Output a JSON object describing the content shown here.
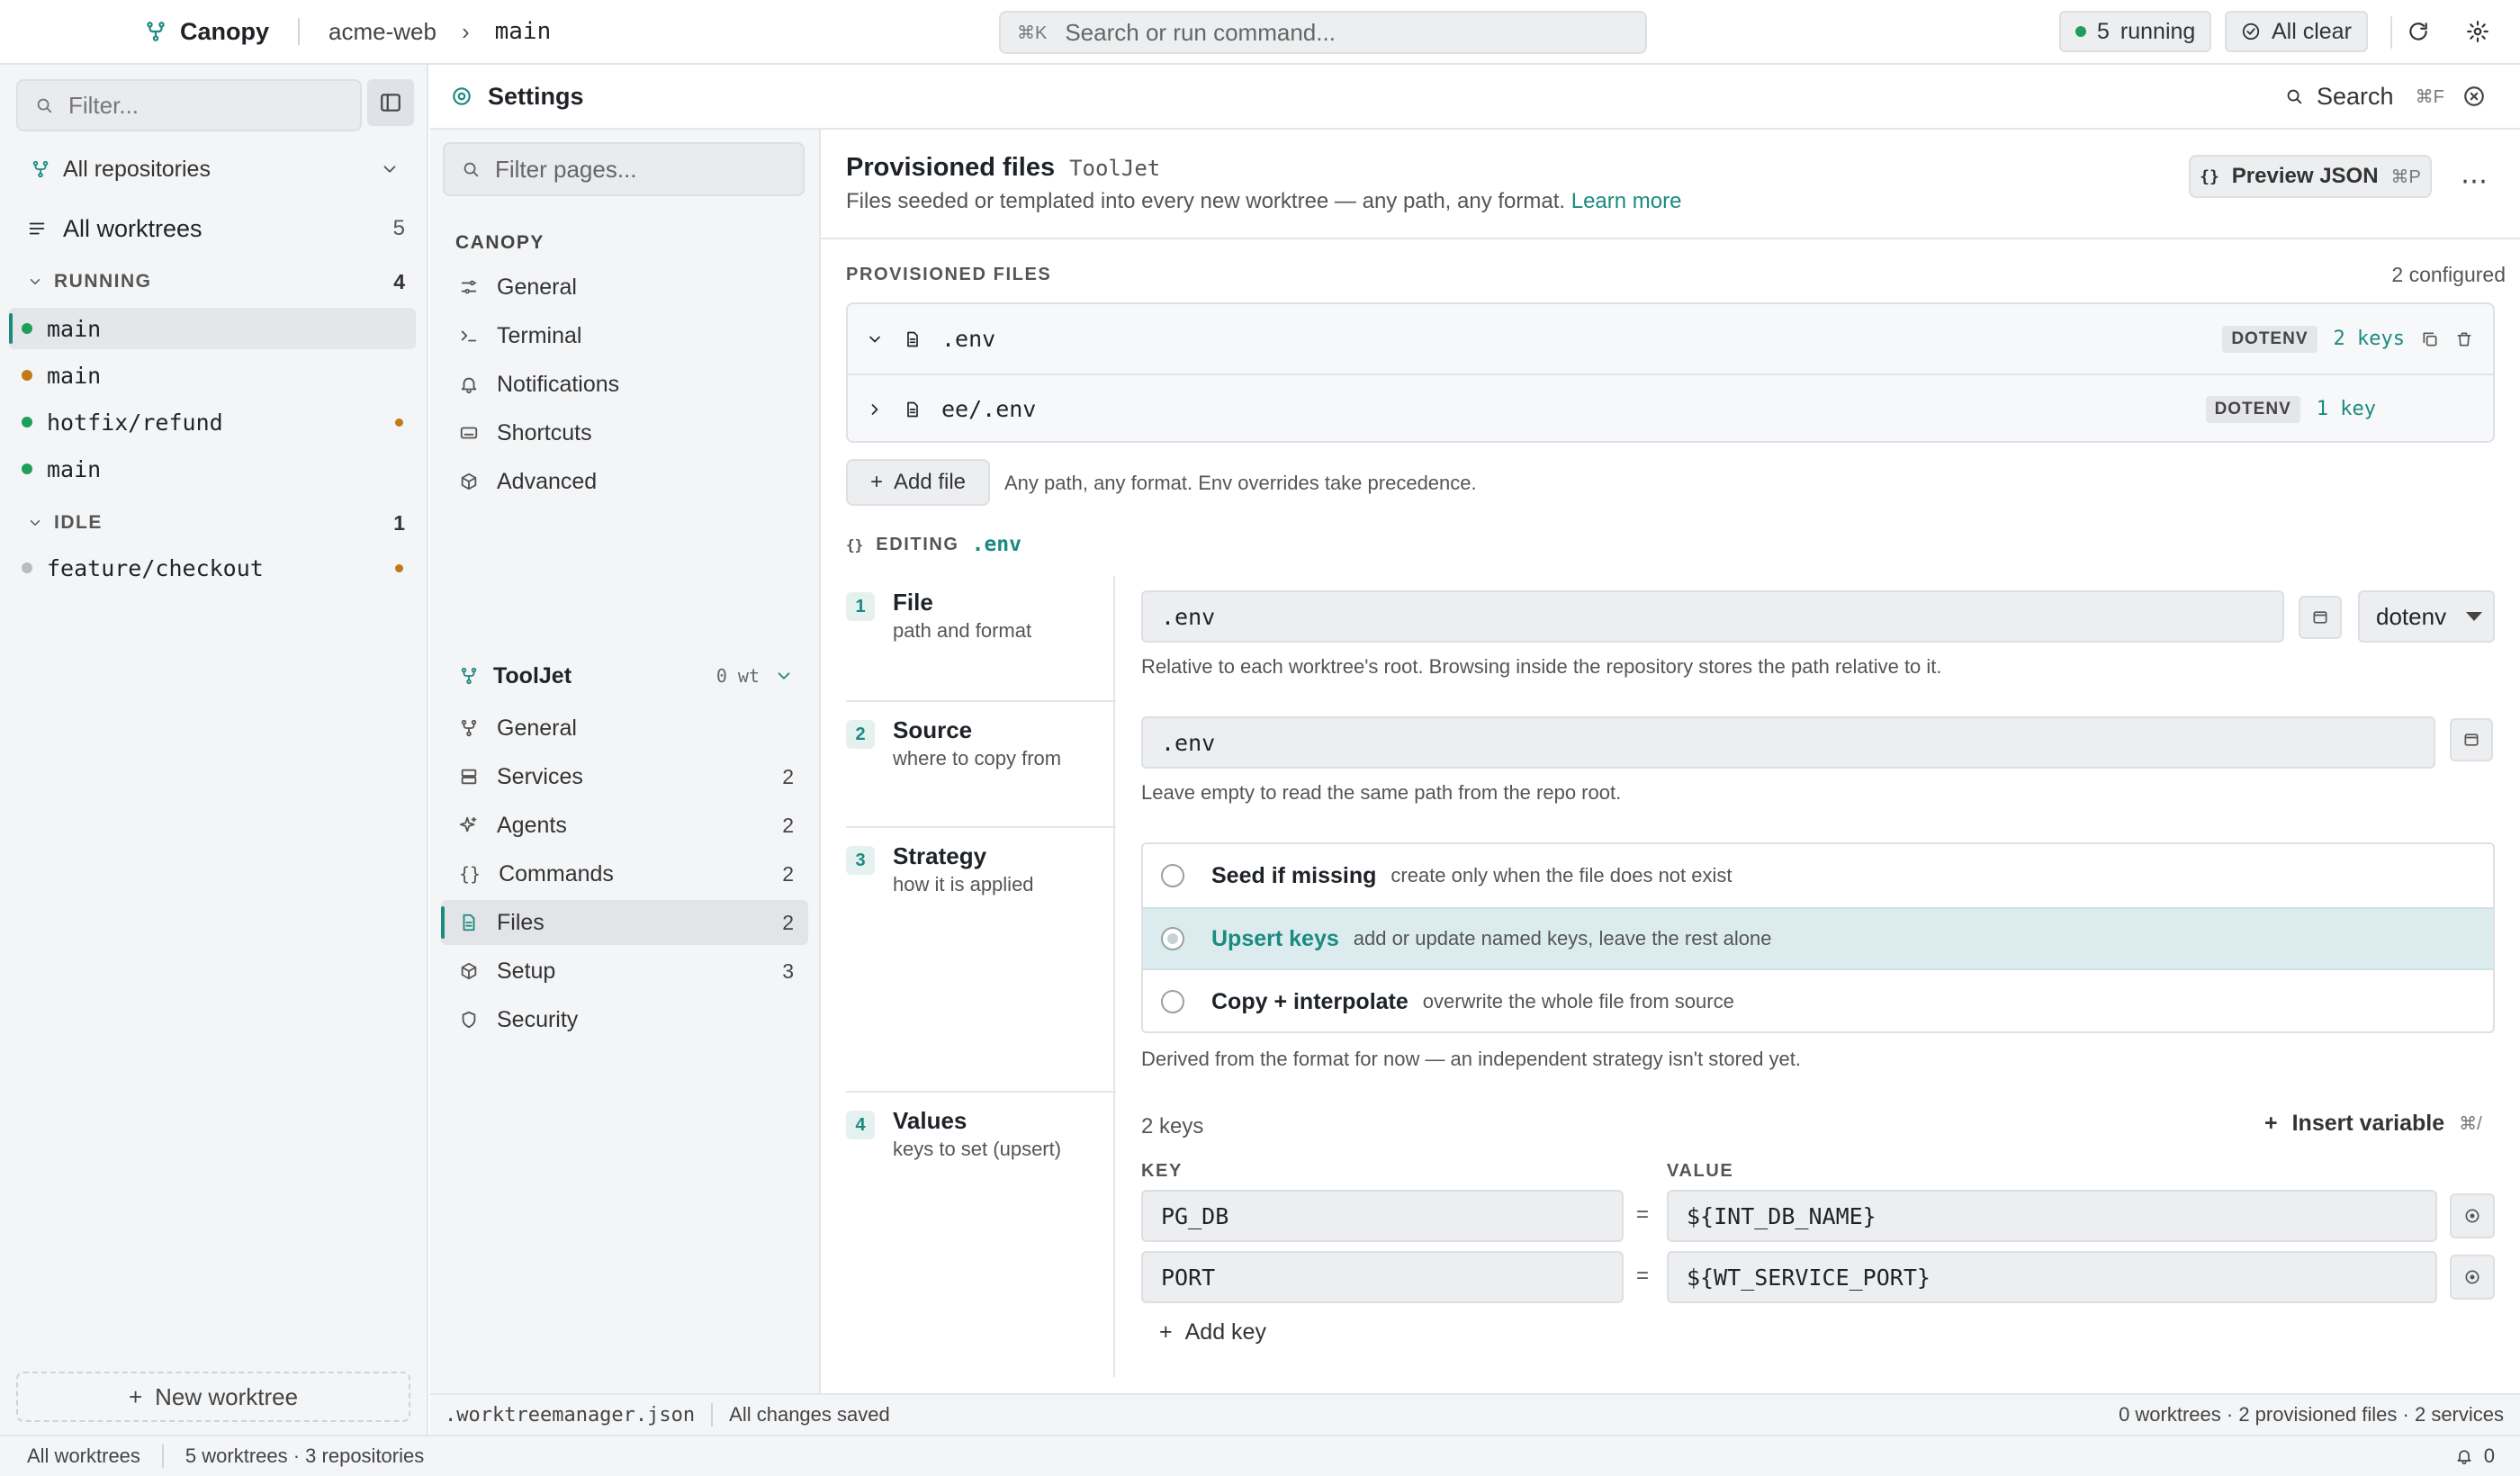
{
  "topbar": {
    "app_name": "Canopy",
    "repo": "acme-web",
    "branch": "main",
    "search_shortcut": "⌘K",
    "search_placeholder": "Search or run command...",
    "running_count": "5",
    "running_label": "running",
    "status_label": "All clear",
    "colors": {
      "accent": "#1b8a80",
      "running": "#1f9e5b"
    }
  },
  "sidebar": {
    "filter_placeholder": "Filter...",
    "repo_selector": "All repositories",
    "all_worktrees_label": "All worktrees",
    "all_worktrees_count": "5",
    "groups": [
      {
        "label": "RUNNING",
        "count": "4",
        "items": [
          {
            "name": "main",
            "status": "green",
            "active": true
          },
          {
            "name": "main",
            "status": "orange",
            "active": false
          },
          {
            "name": "hotfix/refund",
            "status": "green",
            "modified": true
          },
          {
            "name": "main",
            "status": "green",
            "active": false
          }
        ]
      },
      {
        "label": "IDLE",
        "count": "1",
        "items": [
          {
            "name": "feature/checkout",
            "status": "gray",
            "modified": true
          }
        ]
      }
    ],
    "new_worktree_label": "New worktree"
  },
  "settings": {
    "title": "Settings",
    "search_label": "Search",
    "search_shortcut": "⌘F",
    "nav": {
      "filter_placeholder": "Filter pages...",
      "canopy_group": "CANOPY",
      "canopy_items": [
        {
          "label": "General",
          "icon": "sliders-icon"
        },
        {
          "label": "Terminal",
          "icon": "terminal-icon"
        },
        {
          "label": "Notifications",
          "icon": "bell-icon"
        },
        {
          "label": "Shortcuts",
          "icon": "keyboard-icon"
        },
        {
          "label": "Advanced",
          "icon": "cube-icon"
        }
      ],
      "repo_name": "ToolJet",
      "repo_meta": "0 wt",
      "repo_items": [
        {
          "label": "General",
          "icon": "branch-icon",
          "count": ""
        },
        {
          "label": "Services",
          "icon": "server-icon",
          "count": "2"
        },
        {
          "label": "Agents",
          "icon": "sparkle-icon",
          "count": "2"
        },
        {
          "label": "Commands",
          "icon": "braces-icon",
          "count": "2"
        },
        {
          "label": "Files",
          "icon": "file-icon",
          "count": "2",
          "active": true
        },
        {
          "label": "Setup",
          "icon": "cube-icon",
          "count": "3"
        },
        {
          "label": "Security",
          "icon": "shield-icon",
          "count": ""
        }
      ]
    }
  },
  "page": {
    "title": "Provisioned files",
    "repo": "ToolJet",
    "description": "Files seeded or templated into every new worktree — any path, any format.",
    "learn_more": "Learn more",
    "preview_label": "Preview JSON",
    "preview_shortcut": "⌘P",
    "section_label": "PROVISIONED FILES",
    "configured": "2 configured",
    "files": [
      {
        "path": ".env",
        "format": "DOTENV",
        "keys": "2 keys",
        "expanded": true
      },
      {
        "path": "ee/.env",
        "format": "DOTENV",
        "keys": "1 key",
        "expanded": false
      }
    ],
    "add_file_label": "Add file",
    "add_file_hint": "Any path, any format. Env overrides take precedence.",
    "editing_label": "EDITING",
    "editing_file": ".env",
    "steps": [
      {
        "num": "1",
        "title": "File",
        "sub": "path and format"
      },
      {
        "num": "2",
        "title": "Source",
        "sub": "where to copy from"
      },
      {
        "num": "3",
        "title": "Strategy",
        "sub": "how it is applied"
      },
      {
        "num": "4",
        "title": "Values",
        "sub": "keys to set (upsert)"
      }
    ],
    "file_path": ".env",
    "file_format": "dotenv",
    "file_help": "Relative to each worktree's root. Browsing inside the repository stores the path relative to it.",
    "source_path": ".env",
    "source_help": "Leave empty to read the same path from the repo root.",
    "strategies": [
      {
        "name": "Seed if missing",
        "desc": "create only when the file does not exist",
        "selected": false
      },
      {
        "name": "Upsert keys",
        "desc": "add or update named keys, leave the rest alone",
        "selected": true
      },
      {
        "name": "Copy + interpolate",
        "desc": "overwrite the whole file from source",
        "selected": false
      }
    ],
    "strategy_help": "Derived from the format for now — an independent strategy isn't stored yet.",
    "values_count": "2 keys",
    "insert_variable": "Insert variable",
    "insert_shortcut": "⌘/",
    "key_header": "KEY",
    "value_header": "VALUE",
    "equals": "=",
    "rows": [
      {
        "key": "PG_DB",
        "value": "${INT_DB_NAME}"
      },
      {
        "key": "PORT",
        "value": "${WT_SERVICE_PORT}"
      }
    ],
    "add_key_label": "Add key"
  },
  "statusbar": {
    "file": ".worktreemanager.json",
    "save_state": "All changes saved",
    "summary": "0 worktrees · 2 provisioned files · 2 services"
  },
  "footer": {
    "left": "All worktrees",
    "summary": "5 worktrees · 3 repositories",
    "notifications": "0"
  }
}
